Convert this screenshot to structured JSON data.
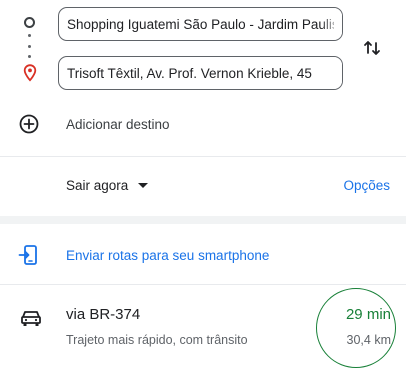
{
  "directions": {
    "origin": {
      "value": "Shopping Iguatemi São Paulo - Jardim Paulistano"
    },
    "destination": {
      "value": "Trisoft Têxtil, Av. Prof. Vernon Krieble, 45"
    },
    "add_destination_label": "Adicionar destino",
    "depart_label": "Sair agora",
    "options_label": "Opções",
    "send_to_phone_label": "Enviar rotas para seu smartphone"
  },
  "route": {
    "name": "via BR-374",
    "description": "Trajeto mais rápido, com trânsito",
    "time": "29 min",
    "distance": "30,4 km"
  },
  "colors": {
    "accent_blue": "#1a73e8",
    "route_green": "#188038",
    "pin_red": "#d93025",
    "text_primary": "#202124",
    "text_secondary": "#5f6368"
  },
  "icons": [
    "origin-circle-icon",
    "dots-connector-icon",
    "location-pin-icon",
    "swap-icon",
    "add-circle-icon",
    "dropdown-caret-icon",
    "phone-send-icon",
    "car-icon"
  ]
}
